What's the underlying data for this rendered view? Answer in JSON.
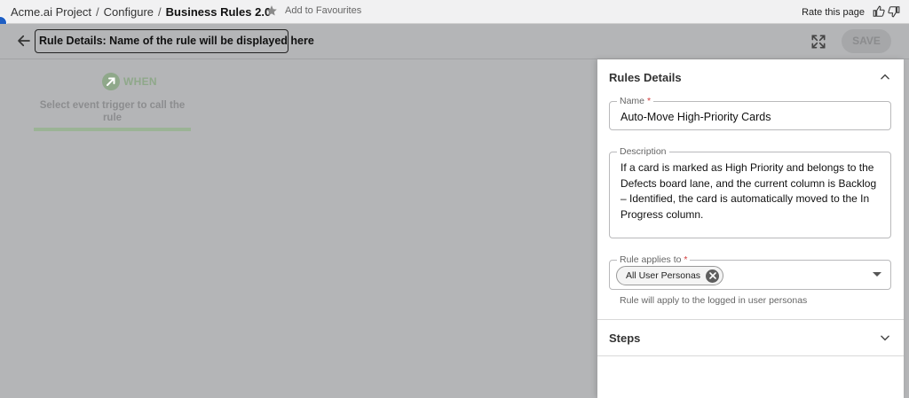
{
  "breadcrumb": {
    "project": "Acme.ai Project",
    "sep1": "/",
    "configure": "Configure",
    "sep2": "/",
    "current": "Business Rules 2.0"
  },
  "favourites": {
    "label": "Add to Favourites",
    "icon": "star-icon"
  },
  "rate": {
    "label": "Rate this page",
    "up_icon": "thumbs-up-icon",
    "down_icon": "thumbs-down-icon"
  },
  "header": {
    "back_icon": "arrow-left-icon",
    "title": "Rule Details: Name of the rule will be displayed here",
    "expand_icon": "expand-icon",
    "save_label": "SAVE"
  },
  "canvas": {
    "when_label": "WHEN",
    "trigger_text": "Select event trigger to call the rule"
  },
  "panel": {
    "rules_details_title": "Rules Details",
    "name_label": "Name",
    "name_value": "Auto-Move High-Priority Cards",
    "description_label": "Description",
    "description_value": "If a card is marked as High Priority and belongs to the Defects board lane, and the current column is Backlog – Identified, the card is automatically moved to the In Progress column.",
    "applies_label": "Rule applies to",
    "applies_chip": "All User Personas",
    "applies_helper": "Rule will apply to the logged in user personas",
    "steps_title": "Steps",
    "required_mark": "*"
  },
  "colors": {
    "overlay": "#b4b5b7",
    "panel_bg": "#ffffff",
    "when_green": "#8fa88a",
    "required_red": "#d23b3b"
  }
}
